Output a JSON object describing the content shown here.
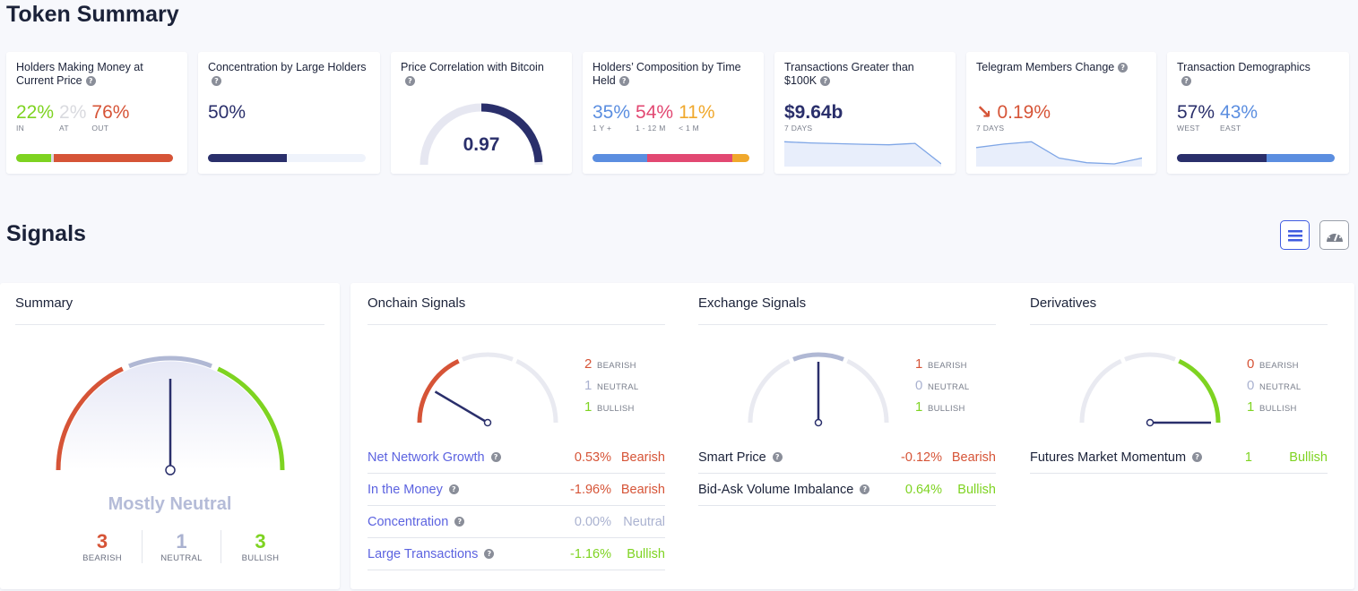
{
  "token_summary": {
    "title": "Token Summary",
    "cards": {
      "holders_money": {
        "title": "Holders Making Money at Current Price",
        "values": [
          {
            "value": "22%",
            "label": "IN",
            "color": "#7ed321",
            "fraction": 0.22
          },
          {
            "value": "2%",
            "label": "AT",
            "color": "#d9dadf",
            "fraction": 0.02
          },
          {
            "value": "76%",
            "label": "OUT",
            "color": "#d65437",
            "fraction": 0.76
          }
        ]
      },
      "concentration": {
        "title": "Concentration by Large Holders",
        "value": "50%",
        "fraction": 0.5,
        "color": "#2a2f6b"
      },
      "correlation": {
        "title": "Price Correlation with Bitcoin",
        "value": "0.97",
        "fraction": 0.97
      },
      "composition": {
        "title": "Holders’ Composition by Time Held",
        "values": [
          {
            "value": "35%",
            "label": "1 Y +",
            "color": "#5b8ee0",
            "fraction": 0.35
          },
          {
            "value": "54%",
            "label": "1 - 12 M",
            "color": "#e24872",
            "fraction": 0.54
          },
          {
            "value": "11%",
            "label": "< 1 M",
            "color": "#f0a82c",
            "fraction": 0.11
          }
        ]
      },
      "transactions": {
        "title": "Transactions Greater than $100K",
        "value": "$9.64b",
        "sublabel": "7 DAYS",
        "spark": [
          0.95,
          0.9,
          0.87,
          0.84,
          0.82,
          0.88,
          0.0
        ]
      },
      "telegram": {
        "title": "Telegram Members Change",
        "value": "0.19%",
        "direction_icon": "arrow-down-right",
        "sublabel": "7 DAYS",
        "spark": [
          0.7,
          0.85,
          0.95,
          0.25,
          0.05,
          0.0,
          0.25
        ]
      },
      "demographics": {
        "title": "Transaction Demographics",
        "values": [
          {
            "value": "57%",
            "label": "WEST",
            "color": "#2a2f6b",
            "fraction": 0.57
          },
          {
            "value": "43%",
            "label": "EAST",
            "color": "#5b8ee0",
            "fraction": 0.43
          }
        ]
      }
    }
  },
  "signals": {
    "title": "Signals",
    "view_buttons": [
      {
        "name": "list-view",
        "icon": "list-icon",
        "active": true
      },
      {
        "name": "gauge-view",
        "icon": "speedometer-icon",
        "active": false
      }
    ],
    "summary": {
      "title": "Summary",
      "verdict": "Mostly Neutral",
      "needle_position": 0.5,
      "counts": [
        {
          "num": "3",
          "label": "BEARISH",
          "color": "#d65437"
        },
        {
          "num": "1",
          "label": "NEUTRAL",
          "color": "#aab2d0"
        },
        {
          "num": "3",
          "label": "BULLISH",
          "color": "#7ed321"
        }
      ]
    },
    "groups": [
      {
        "title": "Onchain Signals",
        "needle_position": 0.17,
        "active_segment": "bearish",
        "legend": [
          {
            "num": "2",
            "label": "BEARISH",
            "color": "#d65437"
          },
          {
            "num": "1",
            "label": "NEUTRAL",
            "color": "#aab2d0"
          },
          {
            "num": "1",
            "label": "BULLISH",
            "color": "#7ed321"
          }
        ],
        "rows": [
          {
            "name": "Net Network Growth",
            "value": "0.53%",
            "verdict": "Bearish",
            "color": "#d65437"
          },
          {
            "name": "In the Money",
            "value": "-1.96%",
            "verdict": "Bearish",
            "color": "#d65437"
          },
          {
            "name": "Concentration",
            "value": "0.00%",
            "verdict": "Neutral",
            "color": "#aab2d0"
          },
          {
            "name": "Large Transactions",
            "value": "-1.16%",
            "verdict": "Bullish",
            "color": "#7ed321"
          }
        ]
      },
      {
        "title": "Exchange Signals",
        "needle_position": 0.5,
        "active_segment": "neutral",
        "legend": [
          {
            "num": "1",
            "label": "BEARISH",
            "color": "#d65437"
          },
          {
            "num": "0",
            "label": "NEUTRAL",
            "color": "#aab2d0"
          },
          {
            "num": "1",
            "label": "BULLISH",
            "color": "#7ed321"
          }
        ],
        "rows": [
          {
            "name": "Smart Price",
            "value": "-0.12%",
            "verdict": "Bearish",
            "color": "#d65437"
          },
          {
            "name": "Bid-Ask Volume Imbalance",
            "value": "0.64%",
            "verdict": "Bullish",
            "color": "#7ed321"
          }
        ]
      },
      {
        "title": "Derivatives",
        "needle_position": 1.0,
        "active_segment": "bullish",
        "legend": [
          {
            "num": "0",
            "label": "BEARISH",
            "color": "#d65437"
          },
          {
            "num": "0",
            "label": "NEUTRAL",
            "color": "#aab2d0"
          },
          {
            "num": "1",
            "label": "BULLISH",
            "color": "#7ed321"
          }
        ],
        "rows": [
          {
            "name": "Futures Market Momentum",
            "value": "1",
            "verdict": "Bullish",
            "color": "#7ed321"
          }
        ]
      }
    ]
  }
}
